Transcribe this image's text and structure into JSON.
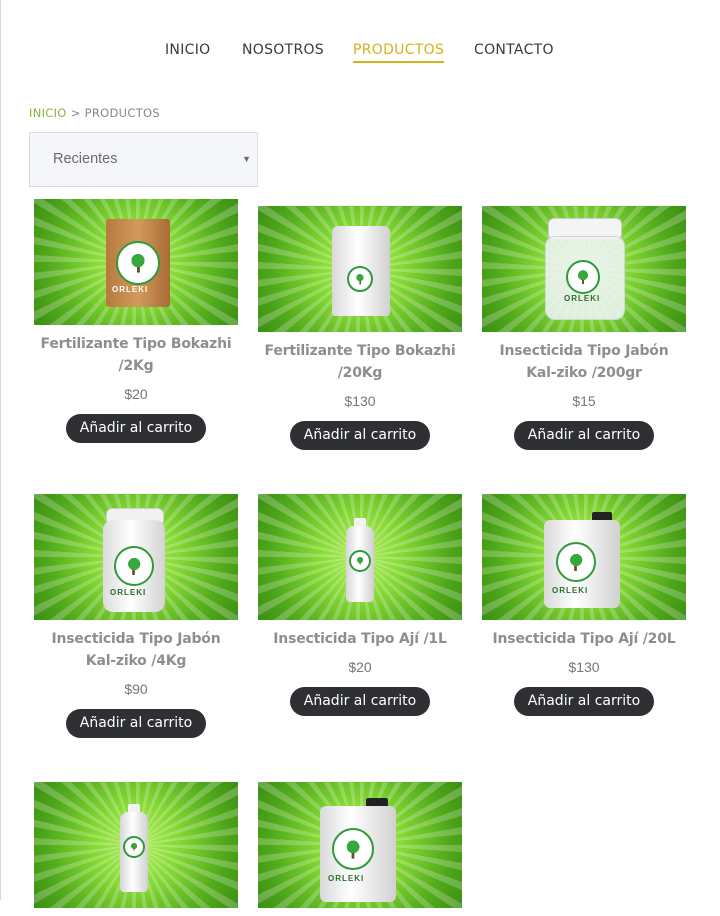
{
  "nav": {
    "items": [
      {
        "label": "INICIO"
      },
      {
        "label": "NOSOTROS"
      },
      {
        "label": "PRODUCTOS"
      },
      {
        "label": "CONTACTO"
      }
    ]
  },
  "breadcrumb": {
    "home": "INICIO",
    "separator": ">",
    "current": "PRODUCTOS"
  },
  "sort": {
    "selected": "Recientes"
  },
  "colors": {
    "accent": "#d4b21a",
    "green": "#8bb33a",
    "button": "#2e3033"
  },
  "brand": {
    "logo_text": "ORLEKI"
  },
  "products": [
    {
      "title": "Fertilizante Tipo Bokazhi /2Kg",
      "price": "$20",
      "button": "Añadir al carrito",
      "image": "kraft-bag"
    },
    {
      "title": "Fertilizante Tipo Bokazhi /20Kg",
      "price": "$130",
      "button": "Añadir al carrito",
      "image": "white-sack"
    },
    {
      "title": "Insecticida Tipo Jabón Kal-ziko /200gr",
      "price": "$15",
      "button": "Añadir al carrito",
      "image": "clear-jar"
    },
    {
      "title": "Insecticida Tipo Jabón Kal-ziko /4Kg",
      "price": "$90",
      "button": "Añadir al carrito",
      "image": "white-tub"
    },
    {
      "title": "Insecticida Tipo Ají /1L",
      "price": "$20",
      "button": "Añadir al carrito",
      "image": "white-bottle"
    },
    {
      "title": "Insecticida Tipo Ají /20L",
      "price": "$130",
      "button": "Añadir al carrito",
      "image": "jerrycan"
    },
    {
      "title": "",
      "price": "",
      "button": "",
      "image": "white-bottle"
    },
    {
      "title": "",
      "price": "",
      "button": "",
      "image": "jerrycan"
    }
  ]
}
